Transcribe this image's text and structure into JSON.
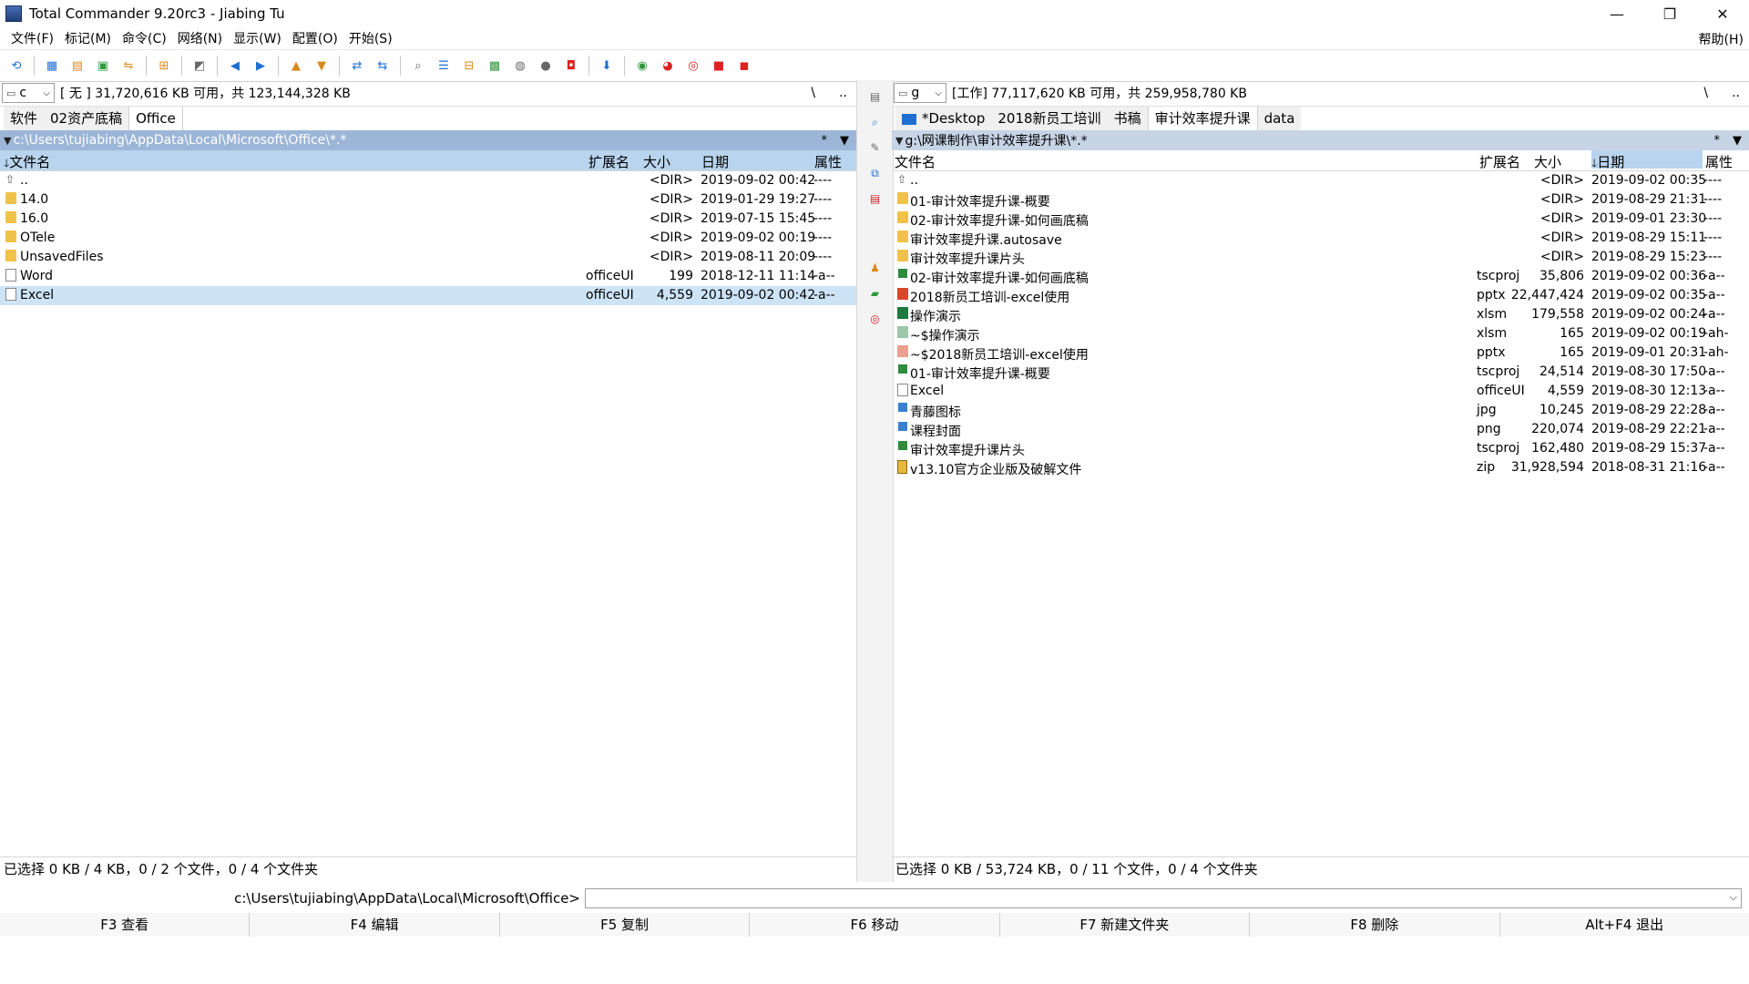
{
  "window": {
    "title": "Total Commander 9.20rc3 - Jiabing Tu",
    "controls": {
      "minimize": "—",
      "maximize": "❐",
      "close": "✕"
    }
  },
  "menu": {
    "items": [
      "文件(F)",
      "标记(M)",
      "命令(C)",
      "网络(N)",
      "显示(W)",
      "配置(O)",
      "开始(S)"
    ],
    "help": "帮助(H)"
  },
  "toolbar": {
    "icons": [
      "refresh-icon",
      "brief-view-icon",
      "tree-view-icon",
      "thumbnail-view-icon",
      "sync-dirs-icon",
      "invert-selection-icon",
      "back-icon",
      "forward-icon",
      "pack-icon",
      "unpack-icon",
      "ftp-connect-icon",
      "url-ftp-icon",
      "search-icon",
      "multi-rename-icon",
      "compare-dirs-icon",
      "copy-names-icon",
      "notepad-icon",
      "bulb-icon",
      "pdf-icon",
      "run-icon",
      "wechat-icon",
      "qq-icon",
      "chrome-icon",
      "app-red-icon",
      "app-pdf-icon"
    ]
  },
  "left": {
    "drive": "c",
    "drive_info": "[ 无 ]  31,720,616 KB 可用，共 123,144,328 KB",
    "nav_root": "\\",
    "nav_up": "..",
    "tabs": [
      "软件",
      "02资产底稿",
      "Office"
    ],
    "path": "c:\\Users\\tujiabing\\AppData\\Local\\Microsoft\\Office\\*.*",
    "path_filter": "*",
    "path_dropdown": "▼",
    "headers": {
      "name": "文件名",
      "ext": "扩展名",
      "size": "大小",
      "date": "日期",
      "attr": "属性",
      "sort_arrow": "🡓"
    },
    "files": [
      {
        "icon": "up",
        "name": "..",
        "ext": "",
        "size": "<DIR>",
        "date": "2019-09-02 00:42",
        "attr": "----"
      },
      {
        "icon": "folder",
        "name": "14.0",
        "ext": "",
        "size": "<DIR>",
        "date": "2019-01-29 19:27",
        "attr": "----"
      },
      {
        "icon": "folder",
        "name": "16.0",
        "ext": "",
        "size": "<DIR>",
        "date": "2019-07-15 15:45",
        "attr": "----"
      },
      {
        "icon": "folder",
        "name": "OTele",
        "ext": "",
        "size": "<DIR>",
        "date": "2019-09-02 00:19",
        "attr": "----"
      },
      {
        "icon": "folder",
        "name": "UnsavedFiles",
        "ext": "",
        "size": "<DIR>",
        "date": "2019-08-11 20:09",
        "attr": "----"
      },
      {
        "icon": "doc",
        "name": "Word",
        "ext": "officeUI",
        "size": "199",
        "date": "2018-12-11 11:14",
        "attr": "-a--"
      },
      {
        "icon": "doc",
        "name": "Excel",
        "ext": "officeUI",
        "size": "4,559",
        "date": "2019-09-02 00:42",
        "attr": "-a--"
      }
    ],
    "status": "已选择 0 KB / 4 KB，0 / 2 个文件，0 / 4 个文件夹"
  },
  "right": {
    "drive": "g",
    "drive_info": "[工作]  77,117,620 KB 可用，共 259,958,780 KB",
    "nav_root": "\\",
    "nav_up": "..",
    "tabs": [
      "*Desktop",
      "2018新员工培训",
      "书稿",
      "审计效率提升课",
      "data"
    ],
    "path": "g:\\网课制作\\审计效率提升课\\*.*",
    "path_filter": "*",
    "path_dropdown": "▼",
    "headers": {
      "name": "文件名",
      "ext": "扩展名",
      "size": "大小",
      "date": "日期",
      "attr": "属性",
      "sort_arrow": "🡓"
    },
    "files": [
      {
        "icon": "up",
        "name": "..",
        "ext": "",
        "size": "<DIR>",
        "date": "2019-09-02 00:35",
        "attr": "----"
      },
      {
        "icon": "folder",
        "name": "01-审计效率提升课-概要",
        "ext": "",
        "size": "<DIR>",
        "date": "2019-08-29 21:31",
        "attr": "----"
      },
      {
        "icon": "folder",
        "name": "02-审计效率提升课-如何画底稿",
        "ext": "",
        "size": "<DIR>",
        "date": "2019-09-01 23:30",
        "attr": "----"
      },
      {
        "icon": "folder",
        "name": "审计效率提升课.autosave",
        "ext": "",
        "size": "<DIR>",
        "date": "2019-08-29 15:11",
        "attr": "----"
      },
      {
        "icon": "folder",
        "name": "审计效率提升课片头",
        "ext": "",
        "size": "<DIR>",
        "date": "2019-08-29 15:23",
        "attr": "----"
      },
      {
        "icon": "green",
        "name": "02-审计效率提升课-如何画底稿",
        "ext": "tscproj",
        "size": "35,806",
        "date": "2019-09-02 00:36",
        "attr": "-a--"
      },
      {
        "icon": "pptx",
        "name": "2018新员工培训-excel使用",
        "ext": "pptx",
        "size": "22,447,424",
        "date": "2019-09-02 00:35",
        "attr": "-a--"
      },
      {
        "icon": "xlsm",
        "name": "操作演示",
        "ext": "xlsm",
        "size": "179,558",
        "date": "2019-09-02 00:24",
        "attr": "-a--"
      },
      {
        "icon": "xlsm-l",
        "name": "~$操作演示",
        "ext": "xlsm",
        "size": "165",
        "date": "2019-09-02 00:19",
        "attr": "-ah-"
      },
      {
        "icon": "pptx-l",
        "name": "~$2018新员工培训-excel使用",
        "ext": "pptx",
        "size": "165",
        "date": "2019-09-01 20:31",
        "attr": "-ah-"
      },
      {
        "icon": "green",
        "name": "01-审计效率提升课-概要",
        "ext": "tscproj",
        "size": "24,514",
        "date": "2019-08-30 17:50",
        "attr": "-a--"
      },
      {
        "icon": "doc",
        "name": "Excel",
        "ext": "officeUI",
        "size": "4,559",
        "date": "2019-08-30 12:13",
        "attr": "-a--"
      },
      {
        "icon": "img",
        "name": "青藤图标",
        "ext": "jpg",
        "size": "10,245",
        "date": "2019-08-29 22:28",
        "attr": "-a--"
      },
      {
        "icon": "img",
        "name": "课程封面",
        "ext": "png",
        "size": "220,074",
        "date": "2019-08-29 22:21",
        "attr": "-a--"
      },
      {
        "icon": "green",
        "name": "审计效率提升课片头",
        "ext": "tscproj",
        "size": "162,480",
        "date": "2019-08-29 15:37",
        "attr": "-a--"
      },
      {
        "icon": "zip",
        "name": "v13.10官方企业版及破解文件",
        "ext": "zip",
        "size": "31,928,594",
        "date": "2018-08-31 21:16",
        "attr": "-a--"
      }
    ],
    "status": "已选择 0 KB / 53,724 KB，0 / 11 个文件，0 / 4 个文件夹"
  },
  "cmdline": {
    "path": "c:\\Users\\tujiabing\\AppData\\Local\\Microsoft\\Office>",
    "value": "",
    "dropdown": "⌵"
  },
  "fkeys": [
    "F3 查看",
    "F4 编辑",
    "F5 复制",
    "F6 移动",
    "F7 新建文件夹",
    "F8 删除",
    "Alt+F4 退出"
  ]
}
